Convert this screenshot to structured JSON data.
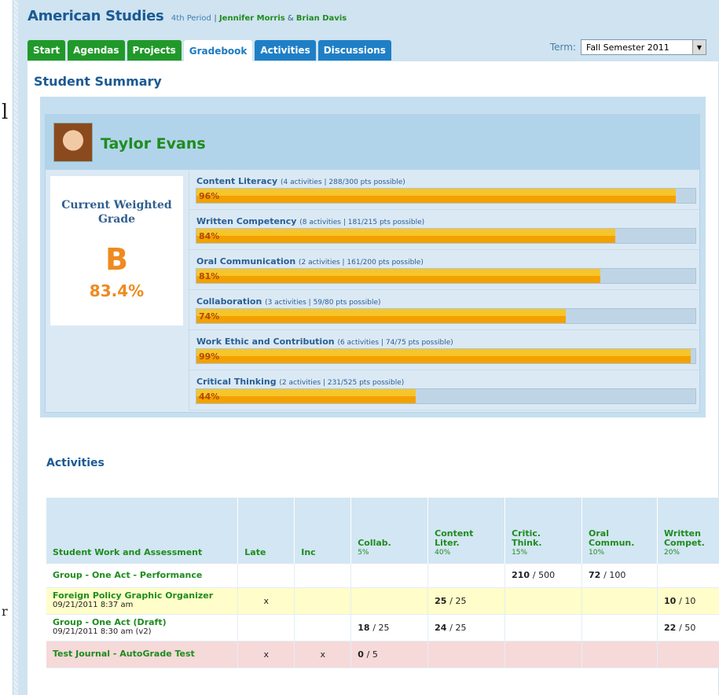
{
  "header": {
    "course_title": "American Studies",
    "period": "4th Period",
    "separator": "|",
    "teacher1": "Jennifer Morris",
    "amp": "&",
    "teacher2": "Brian Davis"
  },
  "tabs": [
    {
      "label": "Start",
      "color": "#21992a"
    },
    {
      "label": "Agendas",
      "color": "#21992a"
    },
    {
      "label": "Projects",
      "color": "#21992a"
    },
    {
      "label": "Gradebook",
      "active": true
    },
    {
      "label": "Activities",
      "color": "#1f7fc6"
    },
    {
      "label": "Discussions",
      "color": "#1f7fc6"
    }
  ],
  "term": {
    "label": "Term:",
    "value": "Fall Semester 2011"
  },
  "page_title": "Student Summary",
  "student": {
    "name": "Taylor Evans"
  },
  "grade": {
    "label_line1": "Current Weighted",
    "label_line2": "Grade",
    "letter": "B",
    "percent": "83.4%"
  },
  "categories": [
    {
      "name": "Content Literacy",
      "meta": "(4 activities   |   288/300 pts possible)",
      "pct_label": "96%",
      "fraction": 0.96
    },
    {
      "name": "Written Competency",
      "meta": "(8 activities   |   181/215 pts possible)",
      "pct_label": "84%",
      "fraction": 0.84
    },
    {
      "name": "Oral Communication",
      "meta": "(2 activities   |   161/200 pts possible)",
      "pct_label": "81%",
      "fraction": 0.81
    },
    {
      "name": "Collaboration",
      "meta": "(3 activities   |   59/80 pts possible)",
      "pct_label": "74%",
      "fraction": 0.74
    },
    {
      "name": "Work Ethic and Contribution",
      "meta": "(6 activities   |   74/75 pts possible)",
      "pct_label": "99%",
      "fraction": 0.99
    },
    {
      "name": "Critical Thinking",
      "meta": "(2 activities   |   231/525 pts possible)",
      "pct_label": "44%",
      "fraction": 0.44
    }
  ],
  "activities": {
    "title": "Activities",
    "columns": [
      {
        "label": "Student Work and Assessment",
        "weight": ""
      },
      {
        "label": "Late",
        "weight": ""
      },
      {
        "label": "Inc",
        "weight": ""
      },
      {
        "label": "Collab.",
        "weight": "5%"
      },
      {
        "label": "Content Liter.",
        "weight": "40%"
      },
      {
        "label": "Critic. Think.",
        "weight": "15%"
      },
      {
        "label": "Oral Commun.",
        "weight": "10%"
      },
      {
        "label": "Written Compet.",
        "weight": "20%"
      }
    ],
    "rows": [
      {
        "name": "Group - One Act - Performance",
        "sub": "",
        "late": "",
        "inc": "",
        "collab": "",
        "content": "",
        "critic": "210  /  500",
        "oral": "72  /  100",
        "written": "",
        "style": "white"
      },
      {
        "name": "Foreign Policy Graphic Organizer",
        "sub": "09/21/2011 8:37 am",
        "late": "x",
        "inc": "",
        "collab": "",
        "content": "25  /  25",
        "critic": "",
        "oral": "",
        "written": "10  /  10",
        "style": "yellow"
      },
      {
        "name": "Group - One Act (Draft)",
        "sub": "09/21/2011 8:30 am (v2)",
        "late": "",
        "inc": "",
        "collab": "18  /  25",
        "content": "24  /  25",
        "critic": "",
        "oral": "",
        "written": "22  /  50",
        "style": "white"
      },
      {
        "name": "Test Journal - AutoGrade Test",
        "sub": "",
        "late": "x",
        "inc": "x",
        "collab": "0 / 5",
        "content": "",
        "critic": "",
        "oral": "",
        "written": "",
        "style": "pink"
      }
    ]
  },
  "gutter_fragments": [
    "l",
    "r"
  ]
}
